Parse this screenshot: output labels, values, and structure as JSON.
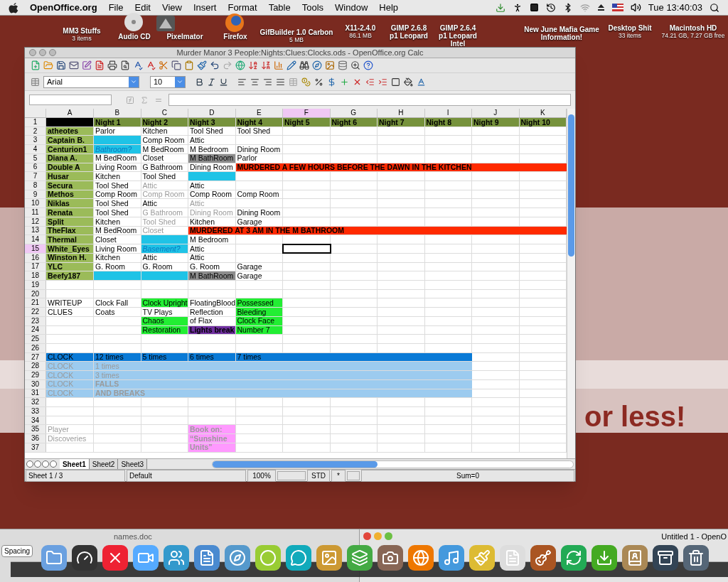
{
  "menubar": {
    "app": "OpenOffice.org",
    "menus": [
      "File",
      "Edit",
      "View",
      "Insert",
      "Format",
      "Table",
      "Tools",
      "Window",
      "Help"
    ],
    "clock": "Tue 13:40:03"
  },
  "desktop_icons": [
    {
      "label": "MM3 Stuffs",
      "sub": "3 items"
    },
    {
      "label": "Audio CD"
    },
    {
      "label": "Pixelmator"
    },
    {
      "label": "Firefox"
    },
    {
      "label": "GifBuilder 1.0 Carbon",
      "sub": "5 MB"
    },
    {
      "label": "X11-2.4.0",
      "sub": "86.1 MB"
    },
    {
      "label": "GIMP 2.6.8 p1 Leopard"
    },
    {
      "label": "GIMP 2.6.4 p1 Leopard Intel"
    },
    {
      "label": "New June Mafia Game Information!"
    },
    {
      "label": "Desktop Shit",
      "sub": "33 items"
    },
    {
      "label": "Macintosh HD",
      "sub": "74.21 GB, 7.27 GB free"
    }
  ],
  "background_text": "or less!",
  "window": {
    "title": "Murder Manor 3 People:Nights:Clues:Clocks.ods - OpenOffice.org Calc",
    "font_name": "Arial",
    "font_size": "10",
    "columns": [
      {
        "letter": "A",
        "selected": false
      },
      {
        "letter": "B",
        "selected": false
      },
      {
        "letter": "C",
        "selected": false
      },
      {
        "letter": "D",
        "selected": false
      },
      {
        "letter": "E",
        "selected": false
      },
      {
        "letter": "F",
        "selected": true
      },
      {
        "letter": "G",
        "selected": false
      },
      {
        "letter": "H",
        "selected": false
      },
      {
        "letter": "I",
        "selected": false
      },
      {
        "letter": "J",
        "selected": false
      },
      {
        "letter": "K",
        "selected": false
      }
    ],
    "rows": [
      {
        "number": "1",
        "selected": false,
        "cells": [
          {
            "color": "#000000"
          },
          {
            "text": "Night 1",
            "kind": "bold",
            "color": "#76923c"
          },
          {
            "text": "Night 2",
            "kind": "bold",
            "color": "#76923c"
          },
          {
            "text": "Night 3",
            "kind": "bold",
            "color": "#76923c"
          },
          {
            "text": "Night 4",
            "kind": "bold",
            "color": "#76923c"
          },
          {
            "text": "Night 5",
            "kind": "bold",
            "color": "#76923c"
          },
          {
            "text": "Night 6",
            "kind": "bold",
            "color": "#76923c"
          },
          {
            "text": "Night 7",
            "kind": "bold",
            "color": "#76923c"
          },
          {
            "text": "Night 8",
            "kind": "bold",
            "color": "#76923c"
          },
          {
            "text": "Night 9",
            "kind": "bold",
            "color": "#76923c"
          },
          {
            "text": "Night 10",
            "kind": "bold",
            "color": "#76923c"
          }
        ]
      },
      {
        "number": "2",
        "selected": false,
        "cells": [
          {
            "text": "atheotes",
            "kind": "bold",
            "color": "#9bbb59"
          },
          {
            "text": "Parlor",
            "kind": "plain"
          },
          {
            "text": "Kitchen",
            "kind": "plain"
          },
          {
            "text": "Tool Shed",
            "kind": "plain"
          },
          {
            "text": "Tool Shed",
            "kind": "plain"
          }
        ]
      },
      {
        "number": "3",
        "selected": false,
        "cells": [
          {
            "text": "Captain B.",
            "kind": "bold",
            "color": "#9bbb59"
          },
          {
            "color": "#1fc3e6"
          },
          {
            "text": "Comp Room",
            "kind": "plain"
          },
          {
            "text": "Attic",
            "kind": "plain"
          }
        ]
      },
      {
        "number": "4",
        "selected": false,
        "cells": [
          {
            "text": "Centurion1",
            "kind": "bold",
            "color": "#9bbb59"
          },
          {
            "text": "Bathroom?",
            "kind": "italic",
            "color": "#1fc3e6"
          },
          {
            "text": "M BedRoom",
            "kind": "plain"
          },
          {
            "text": "M Bedroom",
            "kind": "plain"
          },
          {
            "text": "Dining Room",
            "kind": "plain"
          }
        ]
      },
      {
        "number": "5",
        "selected": false,
        "cells": [
          {
            "text": "Diana A.",
            "kind": "bold",
            "color": "#9bbb59"
          },
          {
            "text": "M BedRoom",
            "kind": "plain"
          },
          {
            "text": "Closet",
            "kind": "plain"
          },
          {
            "text": "M BathRoom",
            "kind": "plain",
            "color": "#8c8c8c"
          },
          {
            "text": "Parlor",
            "kind": "plain"
          }
        ]
      },
      {
        "number": "6",
        "selected": false,
        "cells": [
          {
            "text": "Double A",
            "kind": "bold",
            "color": "#9bbb59"
          },
          {
            "text": "Living Room",
            "kind": "plain"
          },
          {
            "text": "G Bathroom",
            "kind": "plain"
          },
          {
            "text": "Dining Room",
            "kind": "plain"
          },
          {
            "text": "MURDERED A FEW HOURS BEFORE THE DAWN IN THE KITCHEN",
            "kind": "bold",
            "color": "#ff2a00"
          },
          {
            "color": "#ff2a00"
          },
          {
            "color": "#ff2a00"
          },
          {
            "color": "#ff2a00"
          },
          {
            "color": "#ff2a00"
          },
          {
            "color": "#ff2a00"
          },
          {
            "color": "#ff2a00"
          }
        ]
      },
      {
        "number": "7",
        "selected": false,
        "cells": [
          {
            "text": "Husar",
            "kind": "bold",
            "color": "#9bbb59"
          },
          {
            "text": "Kitchen",
            "kind": "plain"
          },
          {
            "text": "Tool Shed",
            "kind": "plain"
          },
          {
            "color": "#1fc3e6"
          }
        ]
      },
      {
        "number": "8",
        "selected": false,
        "cells": [
          {
            "text": "Secura",
            "kind": "bold",
            "color": "#9bbb59"
          },
          {
            "text": "Tool Shed",
            "kind": "plain"
          },
          {
            "text": "Attic",
            "kind": "faded"
          },
          {
            "text": "Attic",
            "kind": "plain"
          }
        ]
      },
      {
        "number": "9",
        "selected": false,
        "cells": [
          {
            "text": "Methos",
            "kind": "bold",
            "color": "#9bbb59"
          },
          {
            "text": "Comp Room",
            "kind": "plain"
          },
          {
            "text": "Comp Room",
            "kind": "faded"
          },
          {
            "text": "Comp Room",
            "kind": "plain"
          },
          {
            "text": "Comp Room",
            "kind": "plain"
          }
        ]
      },
      {
        "number": "10",
        "selected": false,
        "cells": [
          {
            "text": "Niklas",
            "kind": "bold",
            "color": "#9bbb59"
          },
          {
            "text": "Tool Shed",
            "kind": "plain"
          },
          {
            "text": "Attic",
            "kind": "plain"
          },
          {
            "text": "Attic",
            "kind": "faded"
          }
        ]
      },
      {
        "number": "11",
        "selected": false,
        "cells": [
          {
            "text": "Renata",
            "kind": "bold",
            "color": "#9bbb59"
          },
          {
            "text": "Tool Shed",
            "kind": "plain"
          },
          {
            "text": "G Bathroom",
            "kind": "faded"
          },
          {
            "text": "Dining Room",
            "kind": "faded"
          },
          {
            "text": "Dining Room",
            "kind": "plain"
          }
        ]
      },
      {
        "number": "12",
        "selected": false,
        "cells": [
          {
            "text": "Split",
            "kind": "bold",
            "color": "#9bbb59"
          },
          {
            "text": "Kitchen",
            "kind": "plain"
          },
          {
            "text": "Tool Shed",
            "kind": "faded"
          },
          {
            "text": "Kitchen",
            "kind": "plain"
          },
          {
            "text": "Garage",
            "kind": "plain"
          }
        ]
      },
      {
        "number": "13",
        "selected": false,
        "cells": [
          {
            "text": "TheFlax",
            "kind": "bold",
            "color": "#9bbb59"
          },
          {
            "text": "M BedRoom",
            "kind": "plain"
          },
          {
            "text": "Closet",
            "kind": "faded"
          },
          {
            "text": "MURDERED AT 3 AM IN THE M BATHROOM",
            "kind": "bold",
            "color": "#ff2a00"
          },
          {
            "color": "#ff2a00"
          },
          {
            "color": "#ff2a00"
          },
          {
            "color": "#ff2a00"
          },
          {
            "color": "#ff2a00"
          },
          {
            "color": "#ff2a00"
          },
          {
            "color": "#ff2a00"
          },
          {
            "color": "#ff2a00"
          }
        ]
      },
      {
        "number": "14",
        "selected": false,
        "cells": [
          {
            "text": "Thermal",
            "kind": "bold",
            "color": "#9bbb59"
          },
          {
            "text": "Closet",
            "kind": "plain"
          },
          {
            "color": "#1fc3e6"
          },
          {
            "text": "M Bedroom",
            "kind": "plain"
          }
        ]
      },
      {
        "number": "15",
        "selected": true,
        "cells": [
          {
            "text": "White_Eyes",
            "kind": "bold",
            "color": "#9bbb59"
          },
          {
            "text": "Living Room",
            "kind": "plain"
          },
          {
            "text": "Basement?",
            "kind": "italic",
            "color": "#1fc3e6"
          },
          {
            "text": "Attic",
            "kind": "plain"
          }
        ]
      },
      {
        "number": "16",
        "selected": false,
        "cells": [
          {
            "text": "Winston H.",
            "kind": "bold",
            "color": "#9bbb59"
          },
          {
            "text": "Kitchen",
            "kind": "plain"
          },
          {
            "text": "Attic",
            "kind": "plain"
          },
          {
            "text": "Attic",
            "kind": "plain"
          }
        ]
      },
      {
        "number": "17",
        "selected": false,
        "cells": [
          {
            "text": "YLC",
            "kind": "bold",
            "color": "#9bbb59"
          },
          {
            "text": "G. Room",
            "kind": "plain"
          },
          {
            "text": "G. Room",
            "kind": "plain"
          },
          {
            "text": "G. Room",
            "kind": "plain"
          },
          {
            "text": "Garage",
            "kind": "plain"
          }
        ]
      },
      {
        "number": "18",
        "selected": false,
        "cells": [
          {
            "text": "Beefy187",
            "kind": "bold",
            "color": "#9bbb59"
          },
          {
            "color": "#1fc3e6"
          },
          {
            "color": "#1fc3e6"
          },
          {
            "text": "M BathRoom",
            "kind": "plain",
            "color": "#8c8c8c"
          },
          {
            "text": "Garage",
            "kind": "plain"
          }
        ]
      },
      {
        "number": "19",
        "selected": false
      },
      {
        "number": "20",
        "selected": false
      },
      {
        "number": "21",
        "selected": false,
        "cells": [
          {
            "text": "WRITEUP",
            "kind": "plain"
          },
          {
            "text": "Clock Fall",
            "kind": "plain"
          },
          {
            "text": "Clock Upright",
            "kind": "plain",
            "color": "#22ee33"
          },
          {
            "text": "FloatingBlood",
            "kind": "plain"
          },
          {
            "text": "Possessed",
            "kind": "plain",
            "color": "#22ee33"
          }
        ]
      },
      {
        "number": "22",
        "selected": false,
        "cells": [
          {
            "text": "CLUES",
            "kind": "plain"
          },
          {
            "text": "Coats",
            "kind": "plain"
          },
          {
            "text": "TV Plays",
            "kind": "plain"
          },
          {
            "text": "Reflection",
            "kind": "plain"
          },
          {
            "text": "Bleeding",
            "kind": "plain",
            "color": "#22ee33"
          }
        ]
      },
      {
        "number": "23",
        "selected": false,
        "cells": [
          null,
          null,
          {
            "text": "Chaos",
            "kind": "plain",
            "color": "#22ee33"
          },
          {
            "text": "of Flax",
            "kind": "plain"
          },
          {
            "text": "Clock Face",
            "kind": "plain",
            "color": "#22ee33"
          }
        ]
      },
      {
        "number": "24",
        "selected": false,
        "cells": [
          null,
          null,
          {
            "text": "Restoration",
            "kind": "plain",
            "color": "#22ee33"
          },
          {
            "text": "Lights break",
            "kind": "bold",
            "color": "#7030a0"
          },
          {
            "text": "Number 7",
            "kind": "plain",
            "color": "#22ee33"
          }
        ]
      },
      {
        "number": "25",
        "selected": false
      },
      {
        "number": "26",
        "selected": false
      },
      {
        "number": "27",
        "selected": false,
        "cells": [
          {
            "text": "CLOCK",
            "kind": "plain",
            "color": "#0a7ad6"
          },
          {
            "text": "12 times",
            "kind": "plain",
            "color": "#0a7ad6"
          },
          {
            "text": "5 times",
            "kind": "plain",
            "color": "#0a7ad6"
          },
          {
            "text": "6 times",
            "kind": "plain",
            "color": "#0a7ad6"
          },
          {
            "text": "7 times",
            "kind": "plain",
            "color": "#0a7ad6"
          },
          {
            "color": "#0a7ad6"
          },
          {
            "color": "#0a7ad6"
          },
          {
            "color": "#0a7ad6"
          },
          {
            "color": "#0a7ad6"
          }
        ]
      },
      {
        "number": "28",
        "selected": false,
        "cells": [
          {
            "text": "CLOCK",
            "kind": "faded",
            "color": "#9ccbef"
          },
          {
            "text": "1 times",
            "kind": "faded",
            "color": "#9ccbef"
          },
          {
            "color": "#9ccbef"
          },
          {
            "color": "#9ccbef"
          },
          {
            "color": "#9ccbef"
          },
          {
            "color": "#9ccbef"
          },
          {
            "color": "#9ccbef"
          },
          {
            "color": "#9ccbef"
          },
          {
            "color": "#9ccbef"
          }
        ]
      },
      {
        "number": "29",
        "selected": false,
        "cells": [
          {
            "text": "CLOCK",
            "kind": "faded",
            "color": "#9ccbef"
          },
          {
            "text": "3 times",
            "kind": "faded",
            "color": "#9ccbef"
          },
          {
            "color": "#9ccbef"
          },
          {
            "color": "#9ccbef"
          },
          {
            "color": "#9ccbef"
          },
          {
            "color": "#9ccbef"
          },
          {
            "color": "#9ccbef"
          },
          {
            "color": "#9ccbef"
          },
          {
            "color": "#9ccbef"
          }
        ]
      },
      {
        "number": "30",
        "selected": false,
        "cells": [
          {
            "text": "CLOCK",
            "kind": "faded",
            "color": "#9ccbef"
          },
          {
            "text": "FALLS",
            "kind": "faded_bold",
            "color": "#9ccbef"
          },
          {
            "color": "#9ccbef"
          },
          {
            "color": "#9ccbef"
          },
          {
            "color": "#9ccbef"
          },
          {
            "color": "#9ccbef"
          },
          {
            "color": "#9ccbef"
          },
          {
            "color": "#9ccbef"
          },
          {
            "color": "#9ccbef"
          }
        ]
      },
      {
        "number": "31",
        "selected": false,
        "cells": [
          {
            "text": "CLOCK",
            "kind": "faded",
            "color": "#9ccbef"
          },
          {
            "text": "AND BREAKS",
            "kind": "faded_bold",
            "color": "#9ccbef"
          },
          {
            "color": "#9ccbef"
          },
          {
            "color": "#9ccbef"
          },
          {
            "color": "#9ccbef"
          },
          {
            "color": "#9ccbef"
          },
          {
            "color": "#9ccbef"
          },
          {
            "color": "#9ccbef"
          },
          {
            "color": "#9ccbef"
          }
        ]
      },
      {
        "number": "32",
        "selected": false
      },
      {
        "number": "33",
        "selected": false
      },
      {
        "number": "34",
        "selected": false
      },
      {
        "number": "35",
        "selected": false,
        "cells": [
          {
            "text": "Player",
            "kind": "faded"
          },
          null,
          null,
          {
            "text": "Book on:",
            "kind": "faded_bold",
            "color": "#ff99ff"
          }
        ]
      },
      {
        "number": "36",
        "selected": false,
        "cells": [
          {
            "text": "Discoveries",
            "kind": "faded"
          },
          null,
          null,
          {
            "text": "“Sunshine",
            "kind": "faded_bold",
            "color": "#ff99ff"
          }
        ]
      },
      {
        "number": "37",
        "selected": false,
        "cells": [
          null,
          null,
          null,
          {
            "text": "Units”",
            "kind": "faded_bold",
            "color": "#ff99ff"
          }
        ]
      }
    ],
    "sheet_tabs": [
      {
        "label": "Sheet1",
        "selected": true
      },
      {
        "label": "Sheet2",
        "selected": false
      },
      {
        "label": "Sheet3",
        "selected": false
      }
    ],
    "status_bar": {
      "sheet": "Sheet 1 / 3",
      "style": "Default",
      "zoom": "100%",
      "mode": "STD",
      "modified": "*",
      "sum": "Sum=0"
    }
  },
  "behind_windows": {
    "left_button": "Spacing",
    "doc_title": "names.doc",
    "right_title": "Untitled 1 - OpenO"
  }
}
